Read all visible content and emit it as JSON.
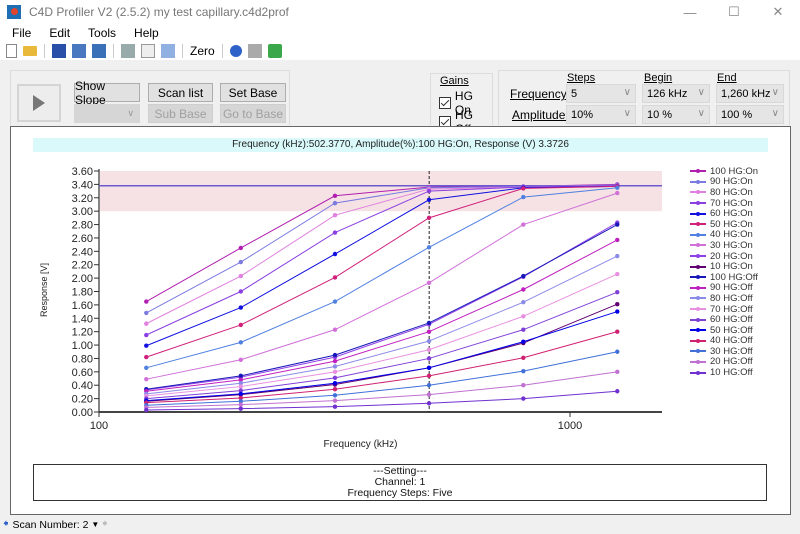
{
  "window": {
    "title": "C4D Profiler V2 (2.5.2) my test capillary.c4d2prof",
    "controls": [
      "minimize",
      "maximize",
      "close"
    ]
  },
  "menu": {
    "items": [
      "File",
      "Edit",
      "Tools",
      "Help"
    ]
  },
  "toolbar": {
    "icons": [
      "new-file-icon",
      "open-folder-icon",
      "save-icon",
      "save-all-icon",
      "export-image-icon",
      "print-icon",
      "print-preview-icon",
      "copy-icon"
    ],
    "zero_label": "Zero",
    "right_icons": [
      "help-icon",
      "monitor-icon",
      "device-icon"
    ]
  },
  "controls": {
    "show_slope": "Show Slope",
    "scan_list": "Scan list",
    "set_base": "Set Base",
    "sub_base": "Sub Base",
    "go_to_base": "Go to Base"
  },
  "gains": {
    "title": "Gains",
    "hg_on": {
      "label": "HG On",
      "checked": true
    },
    "hg_off": {
      "label": "HG Off",
      "checked": true
    }
  },
  "params": {
    "col_steps": "Steps",
    "col_begin": "Begin",
    "col_end": "End",
    "frequency_label": "Frequency:",
    "amplitude_label": "Amplitude:",
    "freq_steps": "5",
    "freq_begin": "126 kHz",
    "freq_end": "1,260 kHz",
    "amp_steps": "10%",
    "amp_begin": "10 %",
    "amp_end": "100 %"
  },
  "info_bar": "Frequency (kHz):502.3770,  Amplitude(%):100 HG:On, Response (V) 3.3726",
  "settings": {
    "line1": "---Setting---",
    "line2": "Channel: 1",
    "line3": "Frequency Steps: Five"
  },
  "statusbar": {
    "scan_label": "Scan Number: 2"
  },
  "chart_data": {
    "type": "line",
    "xlabel": "Frequency (kHz)",
    "ylabel": "Response [V]",
    "xscale": "log",
    "xlim": [
      100,
      1600
    ],
    "ylim": [
      0,
      3.6
    ],
    "x_ticks": [
      100,
      1000
    ],
    "y_ticks": [
      "0.00",
      "0.20",
      "0.40",
      "0.60",
      "0.80",
      "1.00",
      "1.20",
      "1.40",
      "1.60",
      "1.80",
      "2.00",
      "2.20",
      "2.40",
      "2.60",
      "2.80",
      "3.00",
      "3.20",
      "3.40",
      "3.60"
    ],
    "reference_line": 3.38,
    "band": [
      3.0,
      3.6
    ],
    "cursor_x": 502.377,
    "x": [
      126,
      200,
      317,
      502,
      796,
      1260
    ],
    "legend_position": "right",
    "series": [
      {
        "name": "100 HG:On",
        "color": "#b01fb0",
        "values": [
          1.65,
          2.45,
          3.23,
          3.36,
          3.37,
          3.4
        ]
      },
      {
        "name": "90 HG:On",
        "color": "#7a7ae0",
        "values": [
          1.48,
          2.24,
          3.12,
          3.35,
          3.37,
          3.39
        ]
      },
      {
        "name": "80 HG:On",
        "color": "#e080e0",
        "values": [
          1.32,
          2.03,
          2.94,
          3.33,
          3.36,
          3.38
        ]
      },
      {
        "name": "70 HG:On",
        "color": "#8a40e0",
        "values": [
          1.15,
          1.8,
          2.68,
          3.3,
          3.36,
          3.38
        ]
      },
      {
        "name": "60 HG:On",
        "color": "#1010e0",
        "values": [
          0.99,
          1.56,
          2.36,
          3.17,
          3.35,
          3.37
        ]
      },
      {
        "name": "50 HG:On",
        "color": "#d0207a",
        "values": [
          0.82,
          1.3,
          2.01,
          2.9,
          3.34,
          3.37
        ]
      },
      {
        "name": "40 HG:On",
        "color": "#5080e0",
        "values": [
          0.66,
          1.04,
          1.65,
          2.46,
          3.21,
          3.35
        ]
      },
      {
        "name": "30 HG:On",
        "color": "#d070d8",
        "values": [
          0.49,
          0.78,
          1.23,
          1.93,
          2.8,
          3.27
        ]
      },
      {
        "name": "20 HG:On",
        "color": "#9040e8",
        "values": [
          0.33,
          0.52,
          0.82,
          1.31,
          2.02,
          2.83
        ]
      },
      {
        "name": "10 HG:On",
        "color": "#600070",
        "values": [
          0.16,
          0.26,
          0.41,
          0.66,
          1.03,
          1.61
        ]
      },
      {
        "name": "100 HG:Off",
        "color": "#1818b8",
        "values": [
          0.34,
          0.54,
          0.85,
          1.33,
          2.03,
          2.8
        ]
      },
      {
        "name": "90 HG:Off",
        "color": "#c020c0",
        "values": [
          0.31,
          0.48,
          0.76,
          1.2,
          1.83,
          2.57
        ]
      },
      {
        "name": "80 HG:Off",
        "color": "#8a8ae8",
        "values": [
          0.27,
          0.43,
          0.68,
          1.06,
          1.64,
          2.33
        ]
      },
      {
        "name": "70 HG:Off",
        "color": "#e890e0",
        "values": [
          0.24,
          0.38,
          0.6,
          0.93,
          1.43,
          2.06
        ]
      },
      {
        "name": "60 HG:Off",
        "color": "#8040d8",
        "values": [
          0.2,
          0.32,
          0.51,
          0.8,
          1.23,
          1.79
        ]
      },
      {
        "name": "50 HG:Off",
        "color": "#0000e8",
        "values": [
          0.17,
          0.27,
          0.43,
          0.66,
          1.05,
          1.5
        ]
      },
      {
        "name": "40 HG:Off",
        "color": "#d02070",
        "values": [
          0.14,
          0.21,
          0.34,
          0.54,
          0.81,
          1.2
        ]
      },
      {
        "name": "30 HG:Off",
        "color": "#4070d8",
        "values": [
          0.1,
          0.16,
          0.25,
          0.4,
          0.61,
          0.9
        ]
      },
      {
        "name": "20 HG:Off",
        "color": "#c070d0",
        "values": [
          0.07,
          0.11,
          0.17,
          0.26,
          0.4,
          0.6
        ]
      },
      {
        "name": "10 HG:Off",
        "color": "#7030d0",
        "values": [
          0.03,
          0.05,
          0.08,
          0.13,
          0.2,
          0.31
        ]
      }
    ]
  }
}
